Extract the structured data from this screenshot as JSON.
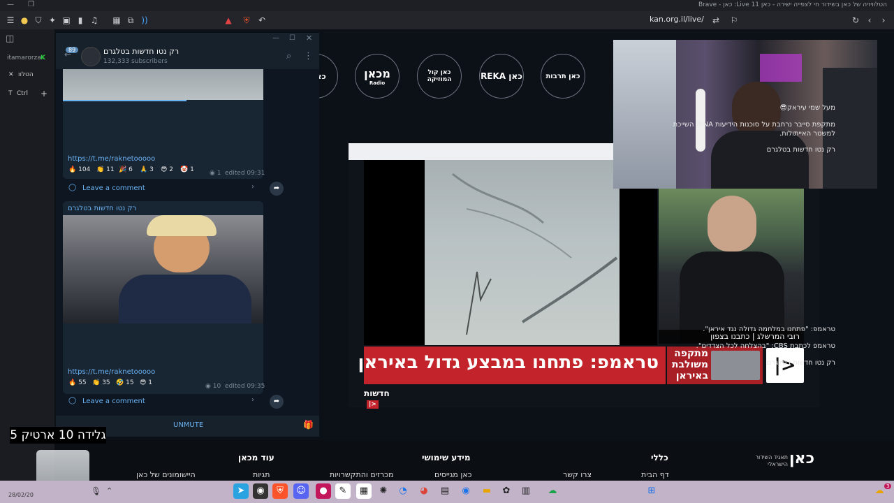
{
  "window": {
    "title": "הטלוויזיה של כאן בשידור חי לצפייה ישירה - כאן 11 Live: כאן - Brave",
    "min_icon": "minimize-icon",
    "restore_icon": "restore-icon"
  },
  "browser": {
    "url": "kan.org.il/live/",
    "icons": [
      "menu-icon",
      "brave-icon",
      "shield-icon",
      "puzzle-icon",
      "wallet-icon",
      "sidebar-icon",
      "music-icon",
      "picture-icon",
      "copy-icon",
      "sound-icon",
      "rewards-icon",
      "vpn-icon",
      "bookmark-icon",
      "reload-icon",
      "back-icon",
      "forward-icon"
    ]
  },
  "left_strip": {
    "profile": "itamarorza",
    "tab_label": "הטלוו",
    "shortcut": "Ctrl",
    "t_label": "T"
  },
  "site": {
    "nav_circles": [
      "כאן ת",
      "מכאן",
      "כאן קול המוזיקה",
      "REKA כאן",
      "כאן תרבות"
    ],
    "makan_sub": "Radio",
    "ticker_headline": "טראמפ: פתחנו במבצע גדול באיראן",
    "ticker_side": "מתקפה משולבת באיראן",
    "ticker_logo": "|>",
    "news_label": "חדשות",
    "reporter_caption": "רובי המרשלג | כתבנו בצפון"
  },
  "footer": {
    "columns": [
      {
        "head": "כללי",
        "links": [
          "דף הבית"
        ]
      },
      {
        "head": "",
        "links": [
          "צרו קשר"
        ]
      },
      {
        "head": "מידע שימושי",
        "links": [
          "כאן מגייסים"
        ]
      },
      {
        "head": "",
        "links": [
          "מכרזים והתקשרויות"
        ]
      },
      {
        "head": "עוד מכאן",
        "links": [
          "תגיות"
        ]
      },
      {
        "head": "",
        "links": [
          "היישומונים של כאן"
        ]
      }
    ],
    "brand": "כאן",
    "brand_sub": "תאגיד השידור הישראלי"
  },
  "telegram": {
    "channel_name": "רק נטו חדשות בטלגרם",
    "subscribers": "132,333 subscribers",
    "unread": "89",
    "posts": [
      {
        "lines": [
          "מעל שמי עיראק😎",
          "מתקפת סייבר נרחבת על סוכנות הידיעות IRNA השייכת",
          "למשטר האייתולות.",
          "רק נטו חדשות בטלגרם"
        ],
        "link": "https://t.me/raknetooooo",
        "reactions": [
          {
            "emoji": "🔥",
            "count": "104"
          },
          {
            "emoji": "👏",
            "count": "11"
          },
          {
            "emoji": "🎉",
            "count": "6"
          },
          {
            "emoji": "🙏",
            "count": "3"
          },
          {
            "emoji": "😎",
            "count": "2"
          },
          {
            "emoji": "🤡",
            "count": "1"
          }
        ],
        "views": "1",
        "edited": "edited 09:31",
        "comment": "Leave a comment"
      },
      {
        "author": "רק נטו חדשות בטלגרם",
        "lines": [
          "טראמפ: \"פתחנו במלחמה גדולה נגד איראן\".",
          "טראמפ לכתבת CBS: \"בהצלחה לכל הצדדים\".",
          "רק נטו חדשות בטלגרם"
        ],
        "link": "https://t.me/raknetooooo",
        "reactions": [
          {
            "emoji": "🔥",
            "count": "55"
          },
          {
            "emoji": "👏",
            "count": "35"
          },
          {
            "emoji": "🤣",
            "count": "15"
          },
          {
            "emoji": "😎",
            "count": "1"
          }
        ],
        "views": "10",
        "edited": "edited 09:35",
        "comment": "Leave a comment"
      }
    ],
    "unmute": "UNMUTE"
  },
  "overlay": {
    "gelida": "גלידה 10 ארטיק 5"
  },
  "taskbar": {
    "date": "28/02/20",
    "badge": "3"
  },
  "colors": {
    "telegram_bg": "#17212b",
    "telegram_link": "#6ab3f3",
    "kan_red": "#c3232a",
    "taskbar": "#c2b3c9"
  }
}
